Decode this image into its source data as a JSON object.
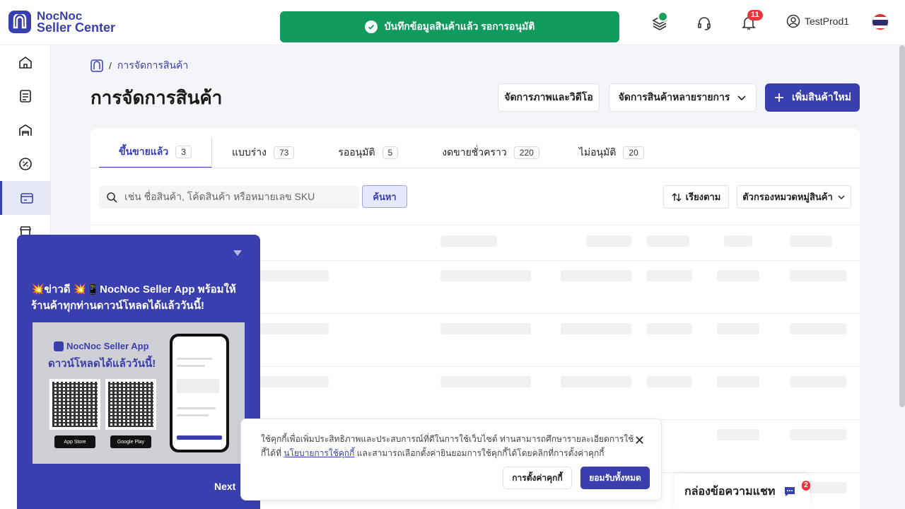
{
  "header": {
    "logo_line1": "NocNoc",
    "logo_line2": "Seller Center",
    "toast_message": "บันทึกข้อมูลสินค้าแล้ว รอการอนุมัติ",
    "notification_count": "11",
    "username": "TestProd1"
  },
  "sidebar": {
    "items": [
      {
        "icon": "home-icon"
      },
      {
        "icon": "orders-icon"
      },
      {
        "icon": "store-icon"
      },
      {
        "icon": "promotion-icon"
      },
      {
        "icon": "products-icon"
      },
      {
        "icon": "shop-icon"
      }
    ]
  },
  "breadcrumb": {
    "current": "การจัดการสินค้า",
    "separator": "/"
  },
  "page": {
    "title": "การจัดการสินค้า",
    "media_button": "จัดการภาพและวิดีโอ",
    "bulk_button": "จัดการสินค้าหลายรายการ",
    "add_button": "เพิ่มสินค้าใหม่"
  },
  "tabs": [
    {
      "label": "ขึ้นขายแล้ว",
      "count": "3"
    },
    {
      "label": "แบบร่าง",
      "count": "73"
    },
    {
      "label": "รออนุมัติ",
      "count": "5"
    },
    {
      "label": "งดขายชั่วคราว",
      "count": "220"
    },
    {
      "label": "ไม่อนุมัติ",
      "count": "20"
    }
  ],
  "toolbar": {
    "search_placeholder": "เช่น ชื่อสินค้า, โค้ดสินค้า หรือหมายเลข SKU",
    "search_button": "ค้นหา",
    "sort_button": "เรียงตาม",
    "filter_button": "ตัวกรองหมวดหมู่สินค้า"
  },
  "promo": {
    "headline": "💥ข่าวดี 💥📱NocNoc Seller App พร้อมให้ร้านค้าทุกท่านดาวน์โหลดได้แล้ววันนี้!",
    "image_title": "NocNoc Seller App",
    "image_subtitle": "ดาวน์โหลดได้แล้ววันนี้!",
    "app_store": "App Store",
    "google_play": "Google Play",
    "next": "Next"
  },
  "cookie": {
    "text_line1": "ใช้คุกกี้เพื่อเพิ่มประสิทธิภาพและประสบการณ์ที่ดีในการใช้เว็บไซต์ ท่านสามารถศึกษารายละเอียดการใช้",
    "text_prefix": "กี้ได้ที่",
    "policy_link": "นโยบายการใช้คุกกี้",
    "text_suffix": "และสามารถเลือกตั้งค่ายินยอมการใช้คุกกี้ได้โดยคลิกที่การตั้งค่าคุกกี้",
    "settings_button": "การตั้งค่าคุกกี้",
    "accept_button": "ยอมรับทั้งหมด"
  },
  "chat": {
    "label": "กล่องข้อความแชท",
    "count": "2"
  },
  "colors": {
    "brand": "#3a3fb0",
    "toast": "#109a5b",
    "badge": "#e8343b"
  }
}
